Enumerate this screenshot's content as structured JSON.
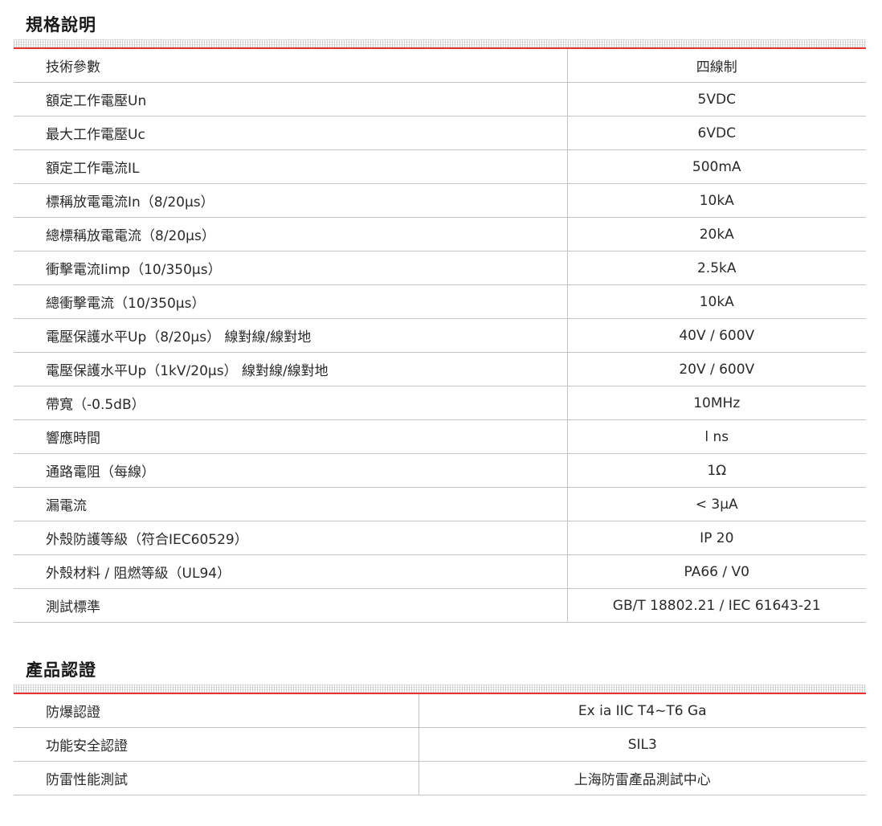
{
  "specs": {
    "title": "規格說明",
    "rows": [
      {
        "label": "技術參數",
        "value": "四線制"
      },
      {
        "label": "額定工作電壓Un",
        "value": "5VDC"
      },
      {
        "label": "最大工作電壓Uc",
        "value": "6VDC"
      },
      {
        "label": "額定工作電流IL",
        "value": "500mA"
      },
      {
        "label": "標稱放電電流In（8/20μs）",
        "value": "10kA"
      },
      {
        "label": "總標稱放電電流（8/20μs）",
        "value": "20kA"
      },
      {
        "label": "衝擊電流Iimp（10/350μs）",
        "value": "2.5kA"
      },
      {
        "label": "總衝擊電流（10/350μs）",
        "value": "10kA"
      },
      {
        "label": "電壓保護水平Up（8/20μs） 線對線/線對地",
        "value": "40V / 600V"
      },
      {
        "label": "電壓保護水平Up（1kV/20μs） 線對線/線對地",
        "value": "20V / 600V"
      },
      {
        "label": "帶寬（-0.5dB）",
        "value": "10MHz"
      },
      {
        "label": "響應時間",
        "value": "l ns"
      },
      {
        "label": "通路電阻（每線）",
        "value": "1Ω"
      },
      {
        "label": "漏電流",
        "value": "< 3μA"
      },
      {
        "label": "外殼防護等級（符合IEC60529）",
        "value": "IP 20"
      },
      {
        "label": "外殼材料 / 阻燃等級（UL94）",
        "value": "PA66 / V0"
      },
      {
        "label": "測試標準",
        "value": "GB/T 18802.21 / IEC 61643-21"
      }
    ]
  },
  "certs": {
    "title": "產品認證",
    "rows": [
      {
        "label": "防爆認證",
        "value": "Ex ia IIC T4~T6 Ga"
      },
      {
        "label": "功能安全認證",
        "value": "SIL3"
      },
      {
        "label": "防雷性能測試",
        "value": "上海防雷產品測試中心"
      }
    ]
  },
  "colors": {
    "accent": "#e8322f",
    "rule": "#c4c4c4"
  }
}
